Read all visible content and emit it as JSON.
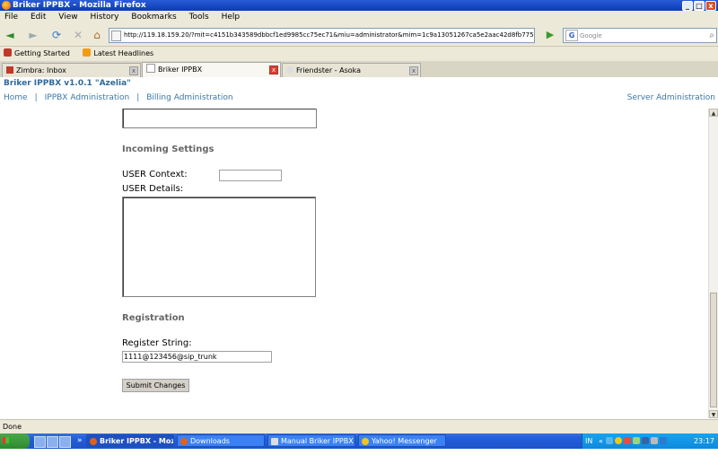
{
  "window": {
    "title": "Briker IPPBX - Mozilla Firefox",
    "minimize": "_",
    "maximize": "□",
    "close": "x"
  },
  "menu": [
    "File",
    "Edit",
    "View",
    "History",
    "Bookmarks",
    "Tools",
    "Help"
  ],
  "nav": {
    "back": "◄",
    "forward": "►",
    "reload": "⟳",
    "stop": "✕",
    "home": "⌂",
    "url": "http://119.18.159.20/?mit=c4151b343589dbbcf1ed9985cc75ec71&miu=administrator&mim=1c9a13051267ca5e2aac42d8fb775a7b",
    "go": "▶",
    "search_placeholder": "Google",
    "search_engine_icon": "G",
    "search_icon": "⌕"
  },
  "bookmarks": [
    {
      "label": "Getting Started",
      "color": "#c0392b"
    },
    {
      "label": "Latest Headlines",
      "color": "#f39c12"
    }
  ],
  "tabs": [
    {
      "label": "Zimbra: Inbox",
      "active": false
    },
    {
      "label": "Briker IPPBX",
      "active": true
    },
    {
      "label": "Friendster - Asoka",
      "active": false
    }
  ],
  "app": {
    "title": "Briker IPPBX v1.0.1 \"Azelia\"",
    "nav": [
      "Home",
      "IPPBX Administration",
      "Billing Administration"
    ],
    "separator": "|",
    "server_admin": "Server Administration"
  },
  "form": {
    "incoming_heading": "Incoming Settings",
    "user_context_label": "USER Context:",
    "user_context_value": "",
    "user_details_label": "USER Details:",
    "user_details_value": "",
    "registration_heading": "Registration",
    "register_string_label": "Register String:",
    "register_string_value": "1111@123456@sip_trunk",
    "submit_label": "Submit Changes"
  },
  "scroll": {
    "up": "▲",
    "down": "▼"
  },
  "status": {
    "text": "Done"
  },
  "taskbar": {
    "start": "Start",
    "chevron": "»",
    "items": [
      {
        "label": "Briker IPPBX - Mozill...",
        "active": true
      },
      {
        "label": "Downloads",
        "active": false
      },
      {
        "label": "Manual Briker IPPBX - Op...",
        "active": false
      },
      {
        "label": "Yahoo! Messenger",
        "active": false
      }
    ],
    "lang": "IN",
    "tray_chevron": "«",
    "clock": "23:17"
  },
  "colors": {
    "link": "#3a78a8",
    "title": "#2f6a9a",
    "heading": "#666666"
  }
}
